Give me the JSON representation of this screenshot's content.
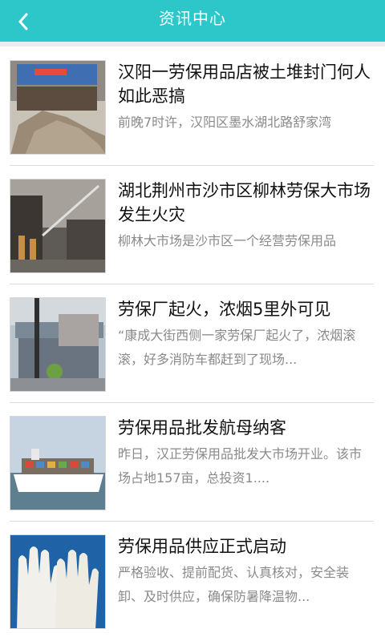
{
  "header": {
    "title": "资讯中心",
    "back_icon": "chevron-left-icon",
    "color": "#2ec7c9"
  },
  "news": [
    {
      "title": "汉阳一劳保用品店被土堆封门何人如此恶搞",
      "desc": "前晚7时许，汉阳区墨水湖北路舒家湾"
    },
    {
      "title": "湖北荆州市沙市区柳林劳保大市场发生火灾",
      "desc": "柳林大市场是沙市区一个经营劳保用品"
    },
    {
      "title": "劳保厂起火，浓烟5里外可见",
      "desc": "“康成大街西侧一家劳保厂起火了，浓烟滚滚，好多消防车都赶到了现场..."
    },
    {
      "title": "劳保用品批发航母纳客",
      "desc": "昨日，汉正劳保用品批发大市场开业。该市场占地157亩，总投资1...."
    },
    {
      "title": "劳保用品供应正式启动",
      "desc": "严格验收、提前配货、认真核对，安全装卸、及时供应，确保防暑降温物..."
    }
  ]
}
